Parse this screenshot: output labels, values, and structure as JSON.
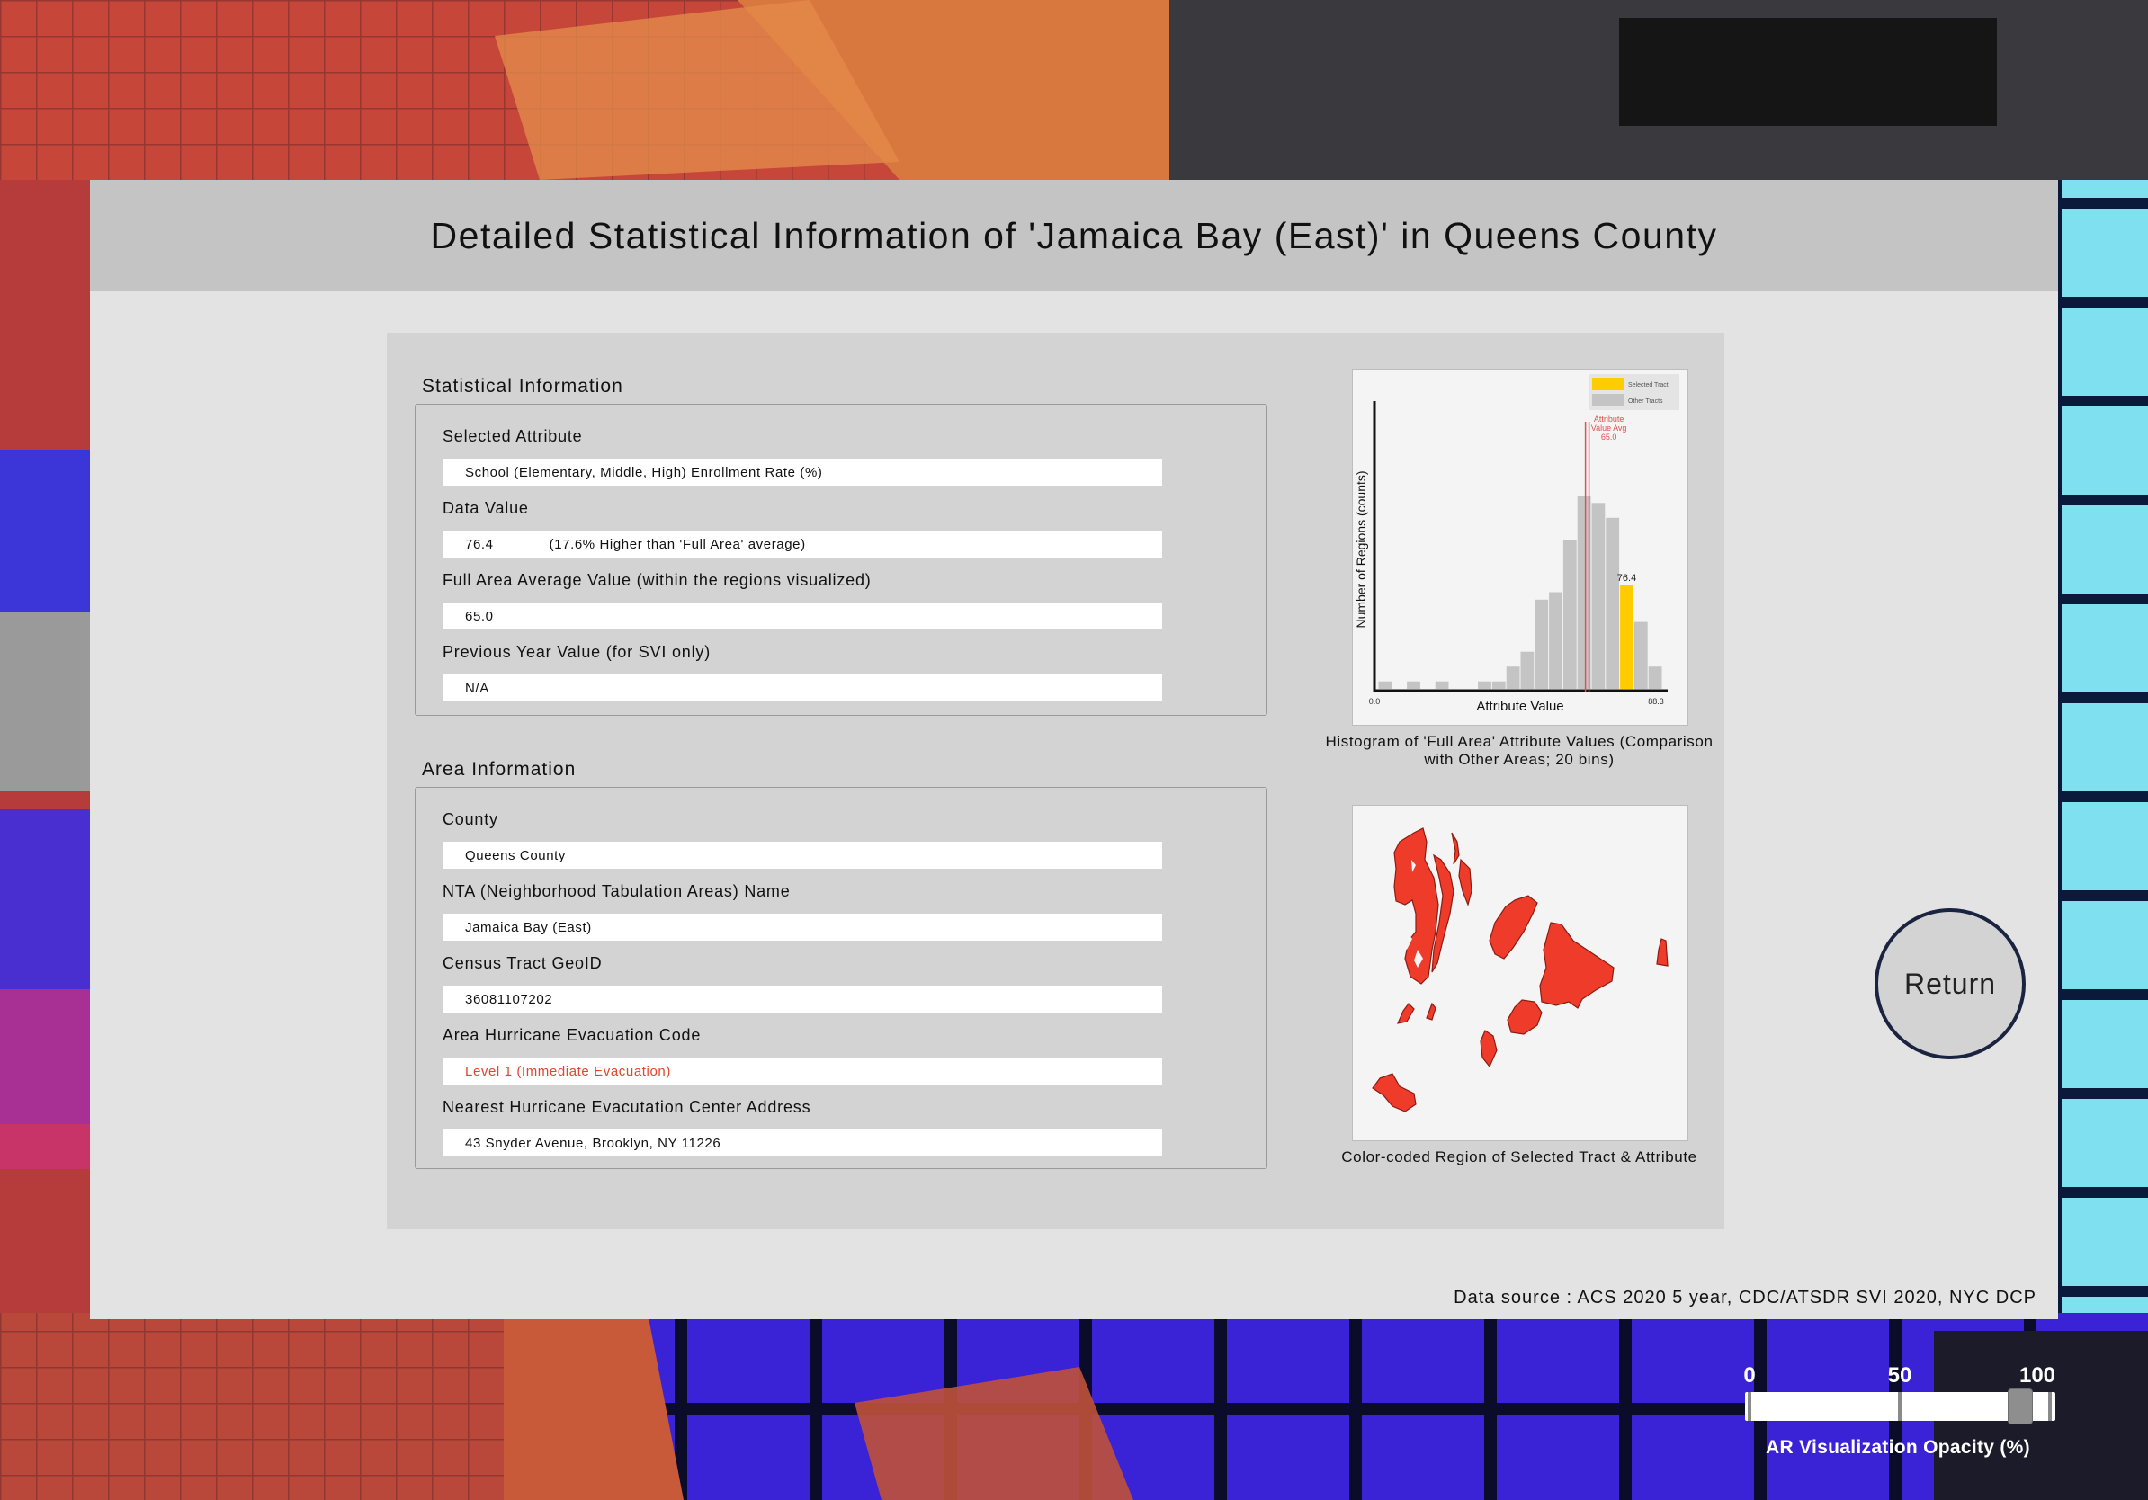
{
  "page_title": "Detailed Statistical Information of 'Jamaica Bay (East)' in Queens County",
  "statistical_info": {
    "section_label": "Statistical Information",
    "selected_attribute_label": "Selected Attribute",
    "selected_attribute_value": "School (Elementary, Middle, High) Enrollment Rate (%)",
    "data_value_label": "Data Value",
    "data_value": "76.4",
    "data_value_note": "(17.6% Higher than 'Full Area' average)",
    "full_area_avg_label": "Full Area Average Value (within the regions visualized)",
    "full_area_avg_value": "65.0",
    "prev_year_label": "Previous Year Value (for SVI only)",
    "prev_year_value": "N/A"
  },
  "area_info": {
    "section_label": "Area Information",
    "county_label": "County",
    "county_value": "Queens County",
    "nta_label": "NTA (Neighborhood Tabulation Areas) Name",
    "nta_value": "Jamaica Bay (East)",
    "geoid_label": "Census Tract GeoID",
    "geoid_value": "36081107202",
    "evac_code_label": "Area Hurricane Evacuation Code",
    "evac_code_value": "Level 1 (Immediate Evacuation)",
    "evac_center_label": "Nearest Hurricane Evacutation Center Address",
    "evac_center_value": "43 Snyder Avenue, Brooklyn, NY 11226"
  },
  "histogram_caption": "Histogram of 'Full Area' Attribute Values (Comparison with Other Areas; 20 bins)",
  "map_caption": "Color-coded Region of Selected Tract & Attribute",
  "return_label": "Return",
  "data_source": "Data source : ACS 2020 5 year, CDC/ATSDR SVI 2020, NYC DCP",
  "opacity_slider": {
    "caption": "AR Visualization Opacity (%)",
    "tick_labels": [
      "0",
      "50",
      "100"
    ],
    "value_percent": 90
  },
  "colors": {
    "selected_tract": "#ffcc00",
    "other_tracts": "#c4c4c4",
    "average_line": "#e05050",
    "map_region": "#ee3b2a",
    "evac_warning": "#e2452c"
  },
  "chart_data": {
    "type": "bar",
    "xlabel": "Attribute Value",
    "ylabel": "Number of Regions (counts)",
    "x_min_label": "0.0",
    "x_max_label": "88.3",
    "bins": 20,
    "values": [
      1,
      0,
      1,
      0,
      1,
      0,
      0,
      1,
      1,
      3,
      5,
      12,
      13,
      20,
      26,
      25,
      23,
      14,
      9,
      3
    ],
    "selected_bin_index": 17,
    "selected_value_label": "76.4",
    "average_value": 65.0,
    "average_label": "Attribute Value Avg 65.0",
    "legend": [
      "Selected Tract",
      "Other Tracts"
    ],
    "legend_position": "top-right"
  }
}
